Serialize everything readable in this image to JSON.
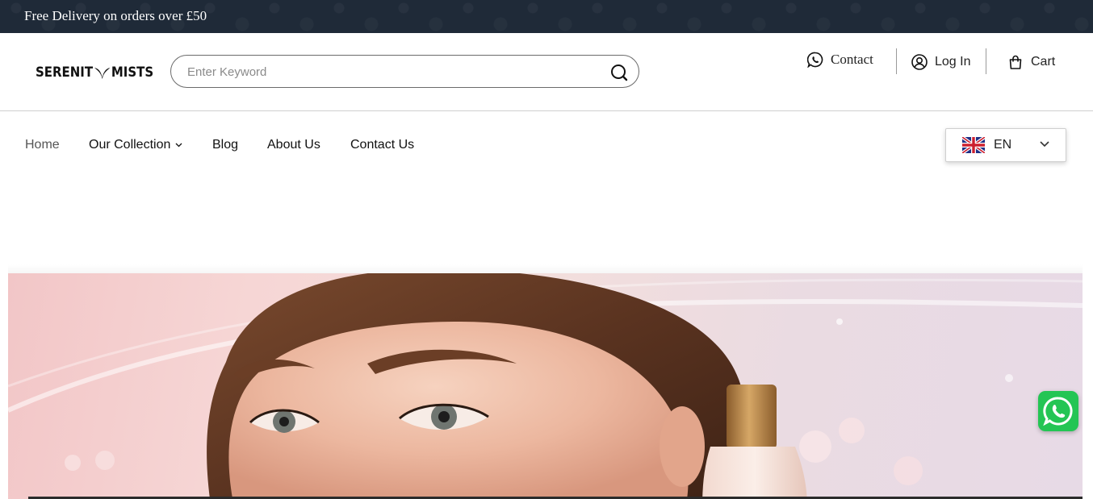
{
  "topbar": {
    "text": "Free Delivery on orders over £50"
  },
  "header": {
    "logo": {
      "left": "SERENIT",
      "right": "MISTS"
    },
    "search": {
      "placeholder": "Enter Keyword",
      "value": "",
      "icon": "search-icon"
    },
    "utilities": [
      {
        "label": "Contact",
        "icon": "whatsapp-icon"
      },
      {
        "label": "Log In",
        "icon": "user-circle-icon"
      },
      {
        "label": "Cart",
        "icon": "shopping-bag-icon"
      }
    ]
  },
  "nav": {
    "items": [
      {
        "label": "Home",
        "active": true
      },
      {
        "label": "Our Collection",
        "has_dropdown": true
      },
      {
        "label": "Blog"
      },
      {
        "label": "About Us"
      },
      {
        "label": "Contact Us"
      }
    ],
    "language": {
      "code": "EN",
      "flag": "uk-flag-icon"
    }
  },
  "hero": {
    "image": "woman-with-perfume-bottle-banner"
  },
  "floating": {
    "icon": "whatsapp-icon"
  },
  "colors": {
    "topbar": "#1f2a38",
    "whatsapp": "#24c554",
    "text": "#111111"
  }
}
